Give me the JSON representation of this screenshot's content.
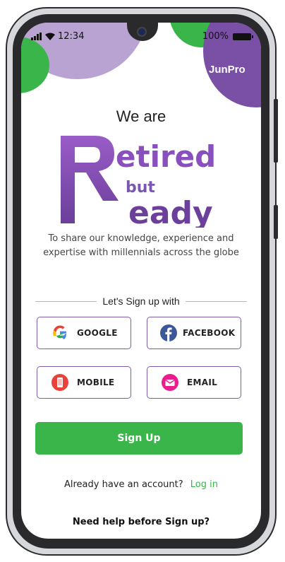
{
  "status_bar": {
    "time": "12:34",
    "battery": "100%"
  },
  "brand": {
    "badge": "JunPro"
  },
  "hero": {
    "intro": "We are",
    "logo_word1": "etired",
    "logo_initial1": "R",
    "logo_word2": "eady",
    "logo_small": "but",
    "tagline": "To share our knowledge, experience and expertise with millennials across the globe"
  },
  "signup_options": {
    "heading": "Let's Sign up with",
    "google": "GOOGLE",
    "facebook": "FACEBOOK",
    "mobile": "MOBILE",
    "email": "EMAIL"
  },
  "actions": {
    "signup": "Sign Up",
    "have_account": "Already have an account?",
    "login": "Log in",
    "help": "Need help before Sign up?"
  },
  "colors": {
    "accent_purple": "#7a4fa6",
    "accent_green": "#3ab54a"
  },
  "icons": [
    "wifi-icon",
    "signal-icon",
    "battery-icon",
    "google-icon",
    "facebook-icon",
    "mobile-icon",
    "email-icon"
  ]
}
